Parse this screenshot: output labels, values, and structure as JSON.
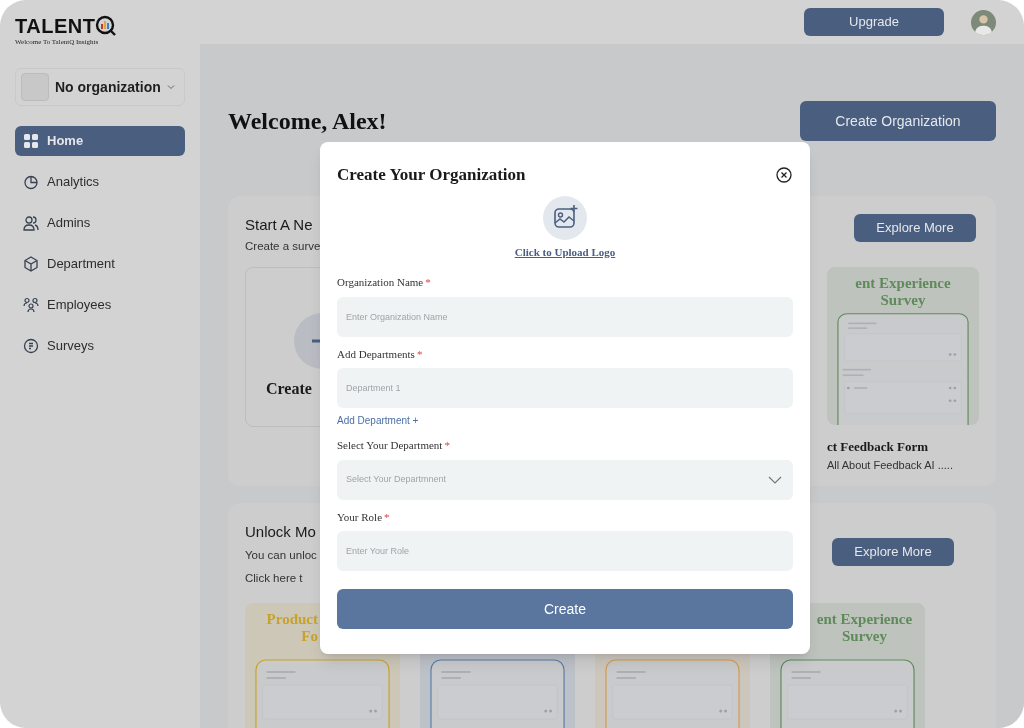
{
  "header": {
    "logo_text": "TALENT",
    "tagline": "Welcome To TalentQ Insights",
    "upgrade": "Upgrade"
  },
  "sidebar": {
    "org_selector": "No organization",
    "items": [
      {
        "label": "Home",
        "selected": true
      },
      {
        "label": "Analytics",
        "selected": false
      },
      {
        "label": "Admins",
        "selected": false
      },
      {
        "label": "Department",
        "selected": false
      },
      {
        "label": "Employees",
        "selected": false
      },
      {
        "label": "Surveys",
        "selected": false
      }
    ]
  },
  "main": {
    "welcome": "Welcome, Alex!",
    "create_org": "Create Organization",
    "start_section": {
      "title": "Start A Ne",
      "subtitle": "Create a surve",
      "create_card": "Create",
      "explore": "Explore More",
      "template": {
        "title_lines": [
          "ent Experience",
          "Survey"
        ],
        "color": "#5f8a5a"
      },
      "form_title": "ct Feedback Form",
      "form_desc": "All About Feedback AI ....."
    },
    "unlock_section": {
      "title": "Unlock Mo",
      "lines": [
        "You can unloc",
        "Click here t"
      ],
      "explore": "Explore More",
      "templates": [
        {
          "title_lines": [
            "Product",
            "Fo"
          ],
          "color": "#c9a227"
        },
        {
          "color": "#5b7aa8"
        },
        {
          "color": "#d49a4a"
        },
        {
          "title_lines": [
            "ent Experience",
            "Survey"
          ],
          "color": "#5f8a5a"
        }
      ]
    }
  },
  "modal": {
    "title": "Create Your Organization",
    "upload": "Click to Upload Logo",
    "fields": [
      {
        "label": "Organization Name",
        "required_mark": "*",
        "placeholder": "Enter Organization Name",
        "kind": "input"
      },
      {
        "label": "Add Departments",
        "required_mark": "*",
        "placeholder": "Department 1",
        "kind": "input",
        "add_link": "Add Department +"
      },
      {
        "label": "Select Your Department",
        "required_mark": "*",
        "placeholder": "Select Your Departmnent",
        "kind": "select"
      },
      {
        "label": "Your Role",
        "required_mark": "*",
        "placeholder": "Enter Your Role",
        "kind": "input"
      }
    ],
    "submit": "Create"
  }
}
